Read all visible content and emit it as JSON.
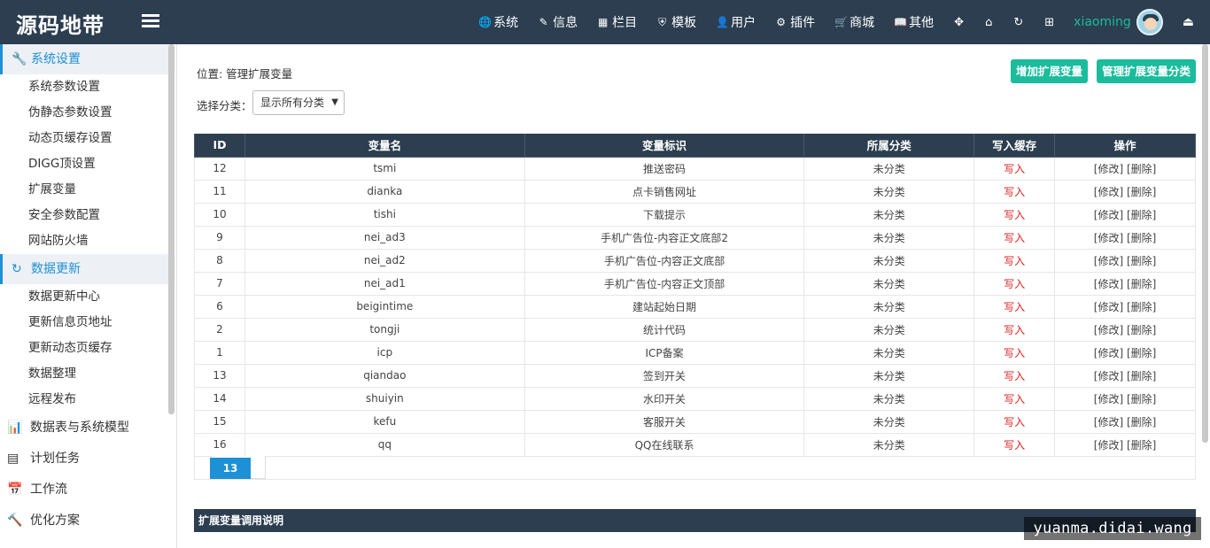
{
  "brand": "源码地带",
  "nav": {
    "items": [
      {
        "icon": "globe-icon",
        "glyph": "🌐",
        "label": "系统"
      },
      {
        "icon": "edit-icon",
        "glyph": "✎",
        "label": "信息"
      },
      {
        "icon": "grid-icon",
        "glyph": "▦",
        "label": "栏目"
      },
      {
        "icon": "shield-icon",
        "glyph": "⛨",
        "label": "模板"
      },
      {
        "icon": "user-icon",
        "glyph": "👤",
        "label": "用户"
      },
      {
        "icon": "plugin-icon",
        "glyph": "⚙",
        "label": "插件"
      },
      {
        "icon": "cart-icon",
        "glyph": "🛒",
        "label": "商城"
      },
      {
        "icon": "book-icon",
        "glyph": "📖",
        "label": "其他"
      }
    ],
    "username": "xiaoming"
  },
  "sidebar": {
    "sections": [
      {
        "label": "系统设置",
        "items": [
          "系统参数设置",
          "伪静态参数设置",
          "动态页缓存设置",
          "DIGG顶设置",
          "扩展变量",
          "安全参数配置",
          "网站防火墙"
        ]
      },
      {
        "label": "数据更新",
        "items": [
          "数据更新中心",
          "更新信息页地址",
          "更新动态页缓存",
          "数据整理",
          "远程发布"
        ]
      }
    ],
    "groups": [
      {
        "icon": "chart-icon",
        "glyph": "📊",
        "label": "数据表与系统模型"
      },
      {
        "icon": "task-icon",
        "glyph": "▤",
        "label": "计划任务"
      },
      {
        "icon": "calendar-icon",
        "glyph": "📅",
        "label": "工作流"
      },
      {
        "icon": "hammer-icon",
        "glyph": "🔨",
        "label": "优化方案"
      }
    ]
  },
  "main": {
    "breadcrumb": "位置: 管理扩展变量",
    "add_button": "增加扩展变量",
    "manage_button": "管理扩展变量分类",
    "filter_label": "选择分类：",
    "filter_value": "显示所有分类",
    "table": {
      "headers": [
        "ID",
        "变量名",
        "变量标识",
        "所属分类",
        "写入缓存",
        "操作"
      ],
      "rows": [
        {
          "id": "12",
          "name": "tsmi",
          "label": "推送密码",
          "category": "未分类",
          "cache": "写入",
          "op": "[修改] [删除]"
        },
        {
          "id": "11",
          "name": "dianka",
          "label": "点卡销售网址",
          "category": "未分类",
          "cache": "写入",
          "op": "[修改] [删除]"
        },
        {
          "id": "10",
          "name": "tishi",
          "label": "下载提示",
          "category": "未分类",
          "cache": "写入",
          "op": "[修改] [删除]"
        },
        {
          "id": "9",
          "name": "nei_ad3",
          "label": "手机广告位-内容正文底部2",
          "category": "未分类",
          "cache": "写入",
          "op": "[修改] [删除]"
        },
        {
          "id": "8",
          "name": "nei_ad2",
          "label": "手机广告位-内容正文底部",
          "category": "未分类",
          "cache": "写入",
          "op": "[修改] [删除]"
        },
        {
          "id": "7",
          "name": "nei_ad1",
          "label": "手机广告位-内容正文顶部",
          "category": "未分类",
          "cache": "写入",
          "op": "[修改] [删除]"
        },
        {
          "id": "6",
          "name": "beigintime",
          "label": "建站起始日期",
          "category": "未分类",
          "cache": "写入",
          "op": "[修改] [删除]"
        },
        {
          "id": "2",
          "name": "tongji",
          "label": "统计代码",
          "category": "未分类",
          "cache": "写入",
          "op": "[修改] [删除]"
        },
        {
          "id": "1",
          "name": "icp",
          "label": "ICP备案",
          "category": "未分类",
          "cache": "写入",
          "op": "[修改] [删除]"
        },
        {
          "id": "13",
          "name": "qiandao",
          "label": "签到开关",
          "category": "未分类",
          "cache": "写入",
          "op": "[修改] [删除]"
        },
        {
          "id": "14",
          "name": "shuiyin",
          "label": "水印开关",
          "category": "未分类",
          "cache": "写入",
          "op": "[修改] [删除]"
        },
        {
          "id": "15",
          "name": "kefu",
          "label": "客服开关",
          "category": "未分类",
          "cache": "写入",
          "op": "[修改] [删除]"
        },
        {
          "id": "16",
          "name": "qq",
          "label": "QQ在线联系",
          "category": "未分类",
          "cache": "写入",
          "op": "[修改] [删除]"
        }
      ]
    },
    "pager_count": "13",
    "footer_title": "扩展变量调用说明"
  },
  "watermark": "yuanma.didai.wang",
  "colors": {
    "topbar": "#2c3e50",
    "accent_green": "#1abc9c",
    "accent_blue": "#1e90d6",
    "cache_red": "#e02020"
  }
}
